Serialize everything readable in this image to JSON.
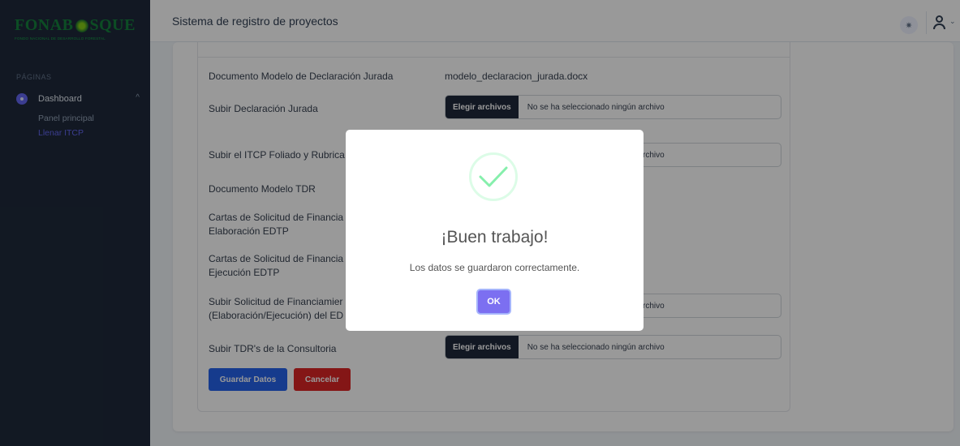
{
  "sidebar": {
    "logo_text_left": "FONAB",
    "logo_text_right": "SQUE",
    "logo_subtitle": "FONDO NACIONAL DE DESARROLLO FORESTAL",
    "section_title": "PÁGINAS",
    "dashboard_label": "Dashboard",
    "items": [
      {
        "label": "Panel principal"
      },
      {
        "label": "Llenar ITCP"
      }
    ]
  },
  "header": {
    "title": "Sistema de registro de proyectos"
  },
  "form": {
    "rows": [
      {
        "label": "Documento Modelo de Declaración Jurada",
        "value": "modelo_declaracion_jurada.docx"
      },
      {
        "label": "Subir Declaración Jurada"
      },
      {
        "label": "Subir el ITCP Foliado y Rubrica"
      },
      {
        "label": "Documento Modelo TDR"
      },
      {
        "label": "Cartas de Solicitud de Financia",
        "label2": "Elaboración EDTP"
      },
      {
        "label": "Cartas de Solicitud de Financia",
        "label2": "Ejecución EDTP"
      },
      {
        "label": "Subir Solicitud de Financiamier",
        "label2": "(Elaboración/Ejecución) del ED"
      },
      {
        "label": "Subir TDR's de la Consultoria"
      }
    ],
    "file_button_label": "Elegir archivos",
    "file_status": "No se ha seleccionado ningún archivo",
    "file_status_partial": "archivo",
    "save_label": "Guardar Datos",
    "cancel_label": "Cancelar"
  },
  "modal": {
    "title": "¡Buen trabajo!",
    "message": "Los datos se guardaron correctamente.",
    "ok_label": "OK"
  },
  "colors": {
    "sidebar_bg": "#1e293b",
    "accent": "#6366f1",
    "save": "#2563eb",
    "cancel": "#dc2626",
    "success": "#4ade80"
  }
}
